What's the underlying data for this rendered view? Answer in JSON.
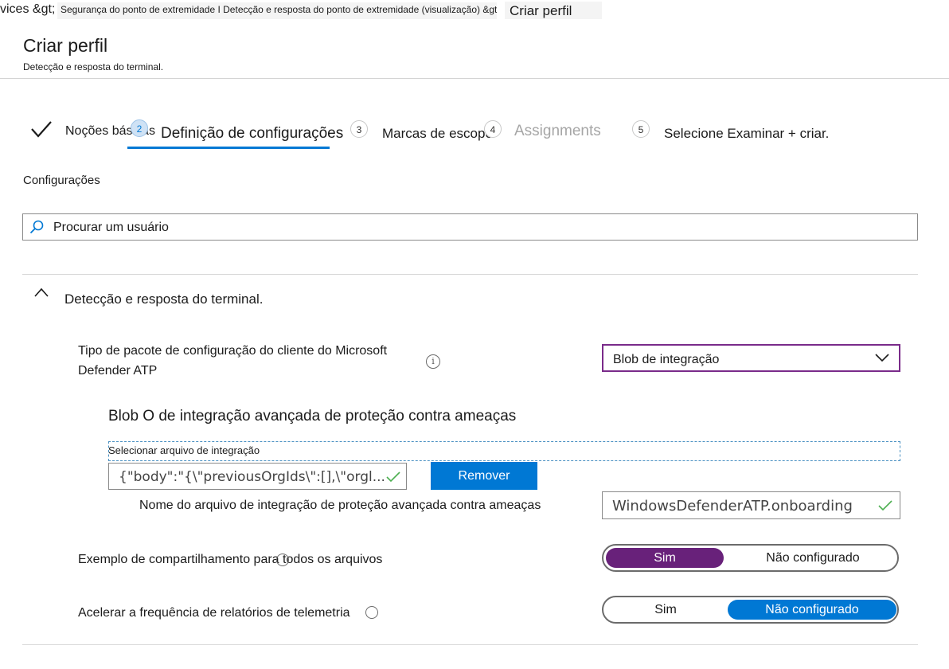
{
  "breadcrumb": {
    "first": "vices &gt;",
    "middle": "Segurança do ponto de extremidade I Detecção e resposta do ponto de extremidade (visualização) &gt",
    "last": "Criar perfil"
  },
  "header": {
    "title": "Criar perfil",
    "subtitle": "Detecção e resposta do terminal."
  },
  "stepper": {
    "steps": [
      {
        "number": "",
        "label": "Noções básicas",
        "state": "done"
      },
      {
        "number": "2",
        "label": "Definição de configurações",
        "state": "active"
      },
      {
        "number": "3",
        "label": "Marcas de escopo",
        "state": "pending"
      },
      {
        "number": "4",
        "label": "Assignments",
        "state": "disabled"
      },
      {
        "number": "5",
        "label": "Selecione Examinar + criar.",
        "state": "pending"
      }
    ]
  },
  "main": {
    "section_label": "Configurações",
    "search": {
      "placeholder": "Procurar um usuário",
      "value": ""
    },
    "section": {
      "title": "Detecção e resposta do terminal.",
      "package_type": {
        "label_line1": "Tipo de pacote de configuração do cliente do Microsoft",
        "label_line2": "Defender ATP",
        "info": "i",
        "selected": "Blob de integração"
      },
      "blob": {
        "heading": "Blob O de integração avançada de proteção contra ameaças",
        "file_label": "Selecionar arquivo de integração",
        "file_value": "{\"body\":\"{\\\"previousOrgIds\\\":[],\\\"orgl...",
        "remove_label": "Remover",
        "filename_label": "Nome do arquivo de integração de proteção avançada contra ameaças",
        "filename_value": "WindowsDefenderATP.onboarding"
      },
      "sample_sharing": {
        "label": "Exemplo de compartilhamento para todos os arquivos",
        "options": [
          "Sim",
          "Não configurado"
        ],
        "selected": "Sim"
      },
      "telemetry": {
        "label": "Acelerar a frequência de relatórios de telemetria",
        "options": [
          "Sim",
          "Não configurado"
        ],
        "selected": "Não configurado"
      }
    }
  },
  "colors": {
    "accent_blue": "#0078d4",
    "accent_purple": "#68217a",
    "dropdown_border": "#7a2b8a",
    "ok_green": "#4caf50"
  }
}
